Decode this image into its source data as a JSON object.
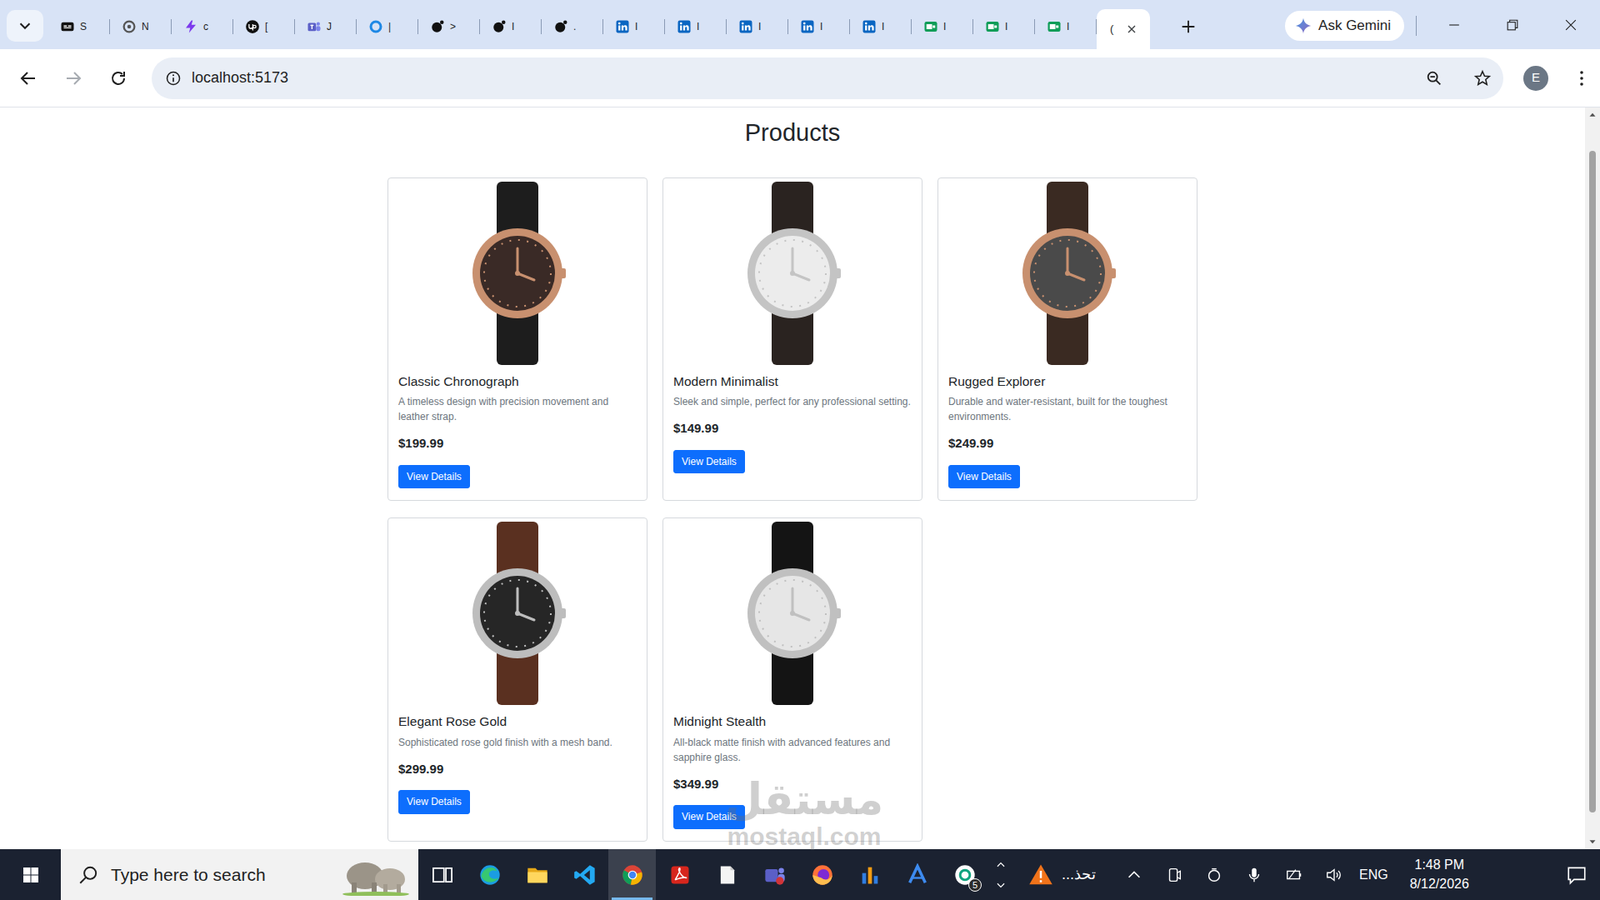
{
  "tab_strip": {
    "tabs": [
      {
        "label": "S",
        "kind": "media",
        "selected": false
      },
      {
        "label": "N",
        "kind": "github",
        "selected": false
      },
      {
        "label": "c",
        "kind": "bolt",
        "selected": false
      },
      {
        "label": "[",
        "kind": "upwork",
        "selected": false
      },
      {
        "label": "J",
        "kind": "teams",
        "selected": false
      },
      {
        "label": "|",
        "kind": "ring",
        "selected": false
      },
      {
        "label": ">",
        "kind": "dark",
        "selected": false
      },
      {
        "label": "I",
        "kind": "dark",
        "selected": false
      },
      {
        "label": ".",
        "kind": "dark",
        "selected": false
      },
      {
        "label": "I",
        "kind": "linkedin",
        "selected": false
      },
      {
        "label": "I",
        "kind": "linkedin",
        "selected": false
      },
      {
        "label": "I",
        "kind": "linkedin",
        "selected": false
      },
      {
        "label": "I",
        "kind": "linkedin",
        "selected": false
      },
      {
        "label": "I",
        "kind": "linkedin",
        "selected": false
      },
      {
        "label": "I",
        "kind": "sheets",
        "selected": false
      },
      {
        "label": "I",
        "kind": "sheets",
        "selected": false
      },
      {
        "label": "I",
        "kind": "sheets",
        "selected": false
      },
      {
        "label": "(",
        "kind": "blank",
        "selected": true
      }
    ],
    "ask_gemini": "Ask Gemini"
  },
  "toolbar": {
    "address": "localhost:5173",
    "profile": "E",
    "back_enabled": true,
    "forward_enabled": false
  },
  "page": {
    "heading": "Products",
    "products": [
      {
        "name": "Classic Chronograph",
        "description": "A timeless design with precision movement and leather strap.",
        "price": "$199.99",
        "button": "View Details"
      },
      {
        "name": "Modern Minimalist",
        "description": "Sleek and simple, perfect for any professional setting.",
        "price": "$149.99",
        "button": "View Details"
      },
      {
        "name": "Rugged Explorer",
        "description": "Durable and water-resistant, built for the toughest environments.",
        "price": "$249.99",
        "button": "View Details"
      },
      {
        "name": "Elegant Rose Gold",
        "description": "Sophisticated rose gold finish with a mesh band.",
        "price": "$299.99",
        "button": "View Details"
      },
      {
        "name": "Midnight Stealth",
        "description": "All-black matte finish with advanced features and sapphire glass.",
        "price": "$349.99",
        "button": "View Details"
      }
    ],
    "scrollbar": {
      "level": 0.93,
      "offset": 0.04
    }
  },
  "watermark": {
    "arabic": "مستقل",
    "latin": "mostaql.com"
  },
  "taskbar": {
    "search": "Type here to search",
    "apps": [
      {
        "kind": "taskview",
        "selected": false,
        "badge": ""
      },
      {
        "kind": "edge",
        "selected": false,
        "badge": ""
      },
      {
        "kind": "explorer",
        "selected": false,
        "badge": ""
      },
      {
        "kind": "vscode",
        "selected": false,
        "badge": ""
      },
      {
        "kind": "chrome",
        "selected": true,
        "badge": ""
      },
      {
        "kind": "acrobat",
        "selected": false,
        "badge": ""
      },
      {
        "kind": "notepad",
        "selected": false,
        "badge": ""
      },
      {
        "kind": "teams",
        "selected": false,
        "badge": ""
      },
      {
        "kind": "firefox",
        "selected": false,
        "badge": ""
      },
      {
        "kind": "chart",
        "selected": false,
        "badge": ""
      },
      {
        "kind": "arc",
        "selected": false,
        "badge": ""
      },
      {
        "kind": "gpt",
        "selected": false,
        "badge": "5"
      }
    ],
    "alert": "تحذ...",
    "language": "ENG",
    "time": "1:48 PM",
    "date": "8/12/2026"
  }
}
